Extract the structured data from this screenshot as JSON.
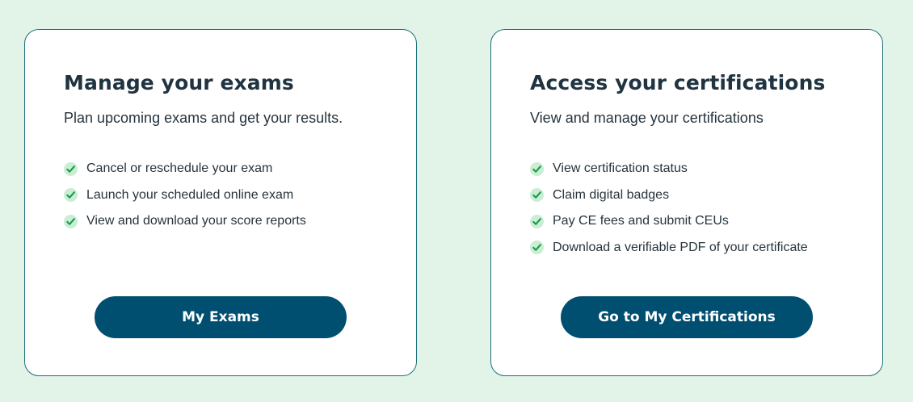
{
  "colors": {
    "page_background": "#e2f3e8",
    "card_border": "#1e6e7a",
    "button_background": "#004f71",
    "check_accent": "#1a9a4a",
    "check_background": "#c9eed4"
  },
  "exams_card": {
    "title": "Manage your exams",
    "subtitle": "Plan upcoming exams and get your results.",
    "features": [
      {
        "icon": "check-icon",
        "label": "Cancel or reschedule your exam"
      },
      {
        "icon": "check-icon",
        "label": "Launch your scheduled online exam"
      },
      {
        "icon": "check-icon",
        "label": "View and download your score reports"
      }
    ],
    "button_label": "My Exams"
  },
  "certifications_card": {
    "title": "Access your certifications",
    "subtitle": "View and manage your certifications",
    "features": [
      {
        "icon": "check-icon",
        "label": "View certification status"
      },
      {
        "icon": "check-icon",
        "label": "Claim digital badges"
      },
      {
        "icon": "check-icon",
        "label": "Pay CE fees and submit CEUs"
      },
      {
        "icon": "check-icon",
        "label": "Download a verifiable PDF of your certificate"
      }
    ],
    "button_label": "Go to My Certifications"
  }
}
